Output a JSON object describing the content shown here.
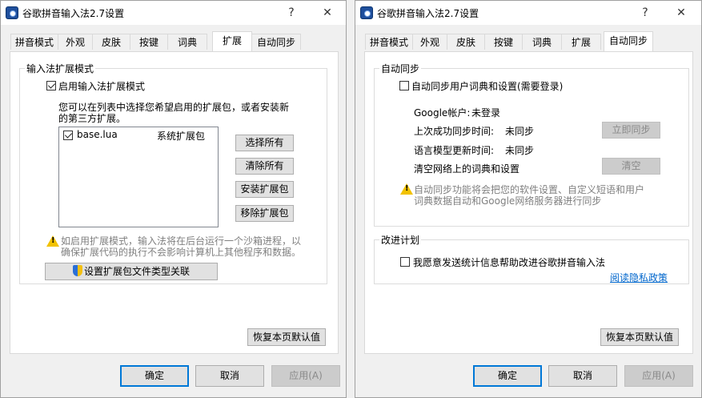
{
  "left_window": {
    "title": "谷歌拼音输入法2.7设置",
    "title_buttons": {
      "help": "?",
      "close": "✕"
    },
    "tabs": [
      "拼音模式",
      "外观",
      "皮肤",
      "按键",
      "词典",
      "扩展",
      "自动同步"
    ],
    "active_tab": "扩展",
    "extension_group": {
      "title": "输入法扩展模式",
      "enable_checkbox": {
        "label": "启用输入法扩展模式",
        "checked": true
      },
      "description_line1": "您可以在列表中选择您希望启用的扩展包，或者安装新",
      "description_line2": "的第三方扩展。",
      "packages": [
        {
          "name": "base.lua",
          "type": "系统扩展包",
          "checked": true
        }
      ],
      "buttons": {
        "select_all": "选择所有",
        "clear_all": "清除所有",
        "install": "安装扩展包",
        "remove": "移除扩展包"
      },
      "warning_line1": "如启用扩展模式，输入法将在后台运行一个沙箱进程，以",
      "warning_line2": "确保扩展代码的执行不会影响计算机上其他程序和数据。",
      "associate_button": "设置扩展包文件类型关联"
    },
    "restore_default": "恢复本页默认值",
    "footer": {
      "ok": "确定",
      "cancel": "取消",
      "apply": "应用(A)"
    }
  },
  "right_window": {
    "title": "谷歌拼音输入法2.7设置",
    "title_buttons": {
      "help": "?",
      "close": "✕"
    },
    "tabs": [
      "拼音模式",
      "外观",
      "皮肤",
      "按键",
      "词典",
      "扩展",
      "自动同步"
    ],
    "active_tab": "自动同步",
    "sync_group": {
      "title": "自动同步",
      "sync_checkbox": {
        "label": "自动同步用户词典和设置(需要登录)",
        "checked": false
      },
      "google_account_label": "Google帐户:",
      "google_account_value": "未登录",
      "last_sync_label": "上次成功同步时间:",
      "last_sync_value": "未同步",
      "model_update_label": "语言模型更新时间:",
      "model_update_value": "未同步",
      "clear_online_label": "清空网络上的词典和设置",
      "sync_now_button": "立即同步",
      "clear_button": "清空",
      "info_line1": "自动同步功能将会把您的软件设置、自定义短语和用户",
      "info_line2": "词典数据自动和Google网络服务器进行同步"
    },
    "improvement_group": {
      "title": "改进计划",
      "stats_checkbox": {
        "label": "我愿意发送统计信息帮助改进谷歌拼音输入法",
        "checked": false
      },
      "privacy_link": "阅读隐私政策"
    },
    "restore_default": "恢复本页默认值",
    "footer": {
      "ok": "确定",
      "cancel": "取消",
      "apply": "应用(A)"
    }
  },
  "colors": {
    "accent_border": "#0078d7",
    "link": "#0066cc",
    "warning": "#f2c200"
  }
}
